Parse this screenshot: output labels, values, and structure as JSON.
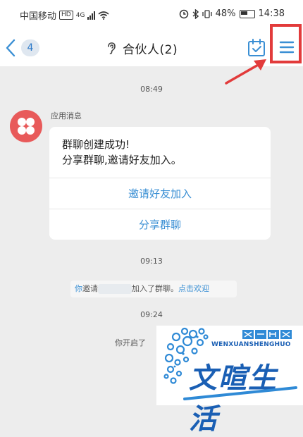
{
  "status_bar": {
    "carrier": "中国移动",
    "hd": "HD",
    "network": "4G",
    "battery": "48%",
    "time": "14:38"
  },
  "nav": {
    "unread_count": "4",
    "title": "合伙人(2)"
  },
  "chat": {
    "time_1": "08:49",
    "sender": "应用消息",
    "card_message": "群聊创建成功!\n分享群聊,邀请好友加入。",
    "invite_button": "邀请好友加入",
    "share_button": "分享群聊",
    "time_2": "09:13",
    "notice_you": "你",
    "notice_invite": "邀请",
    "notice_joined": "加入了群聊。",
    "notice_welcome": "点击欢迎",
    "time_3": "09:24",
    "partial_text": "你开启了"
  },
  "watermark": {
    "latin": "WENXUANSHENGHUO",
    "chinese": "文暄生活"
  },
  "colors": {
    "accent_blue": "#3a8fd4",
    "highlight_red": "#e23b3b",
    "avatar_red": "#e85a5a",
    "watermark_blue": "#1a5fb4"
  }
}
